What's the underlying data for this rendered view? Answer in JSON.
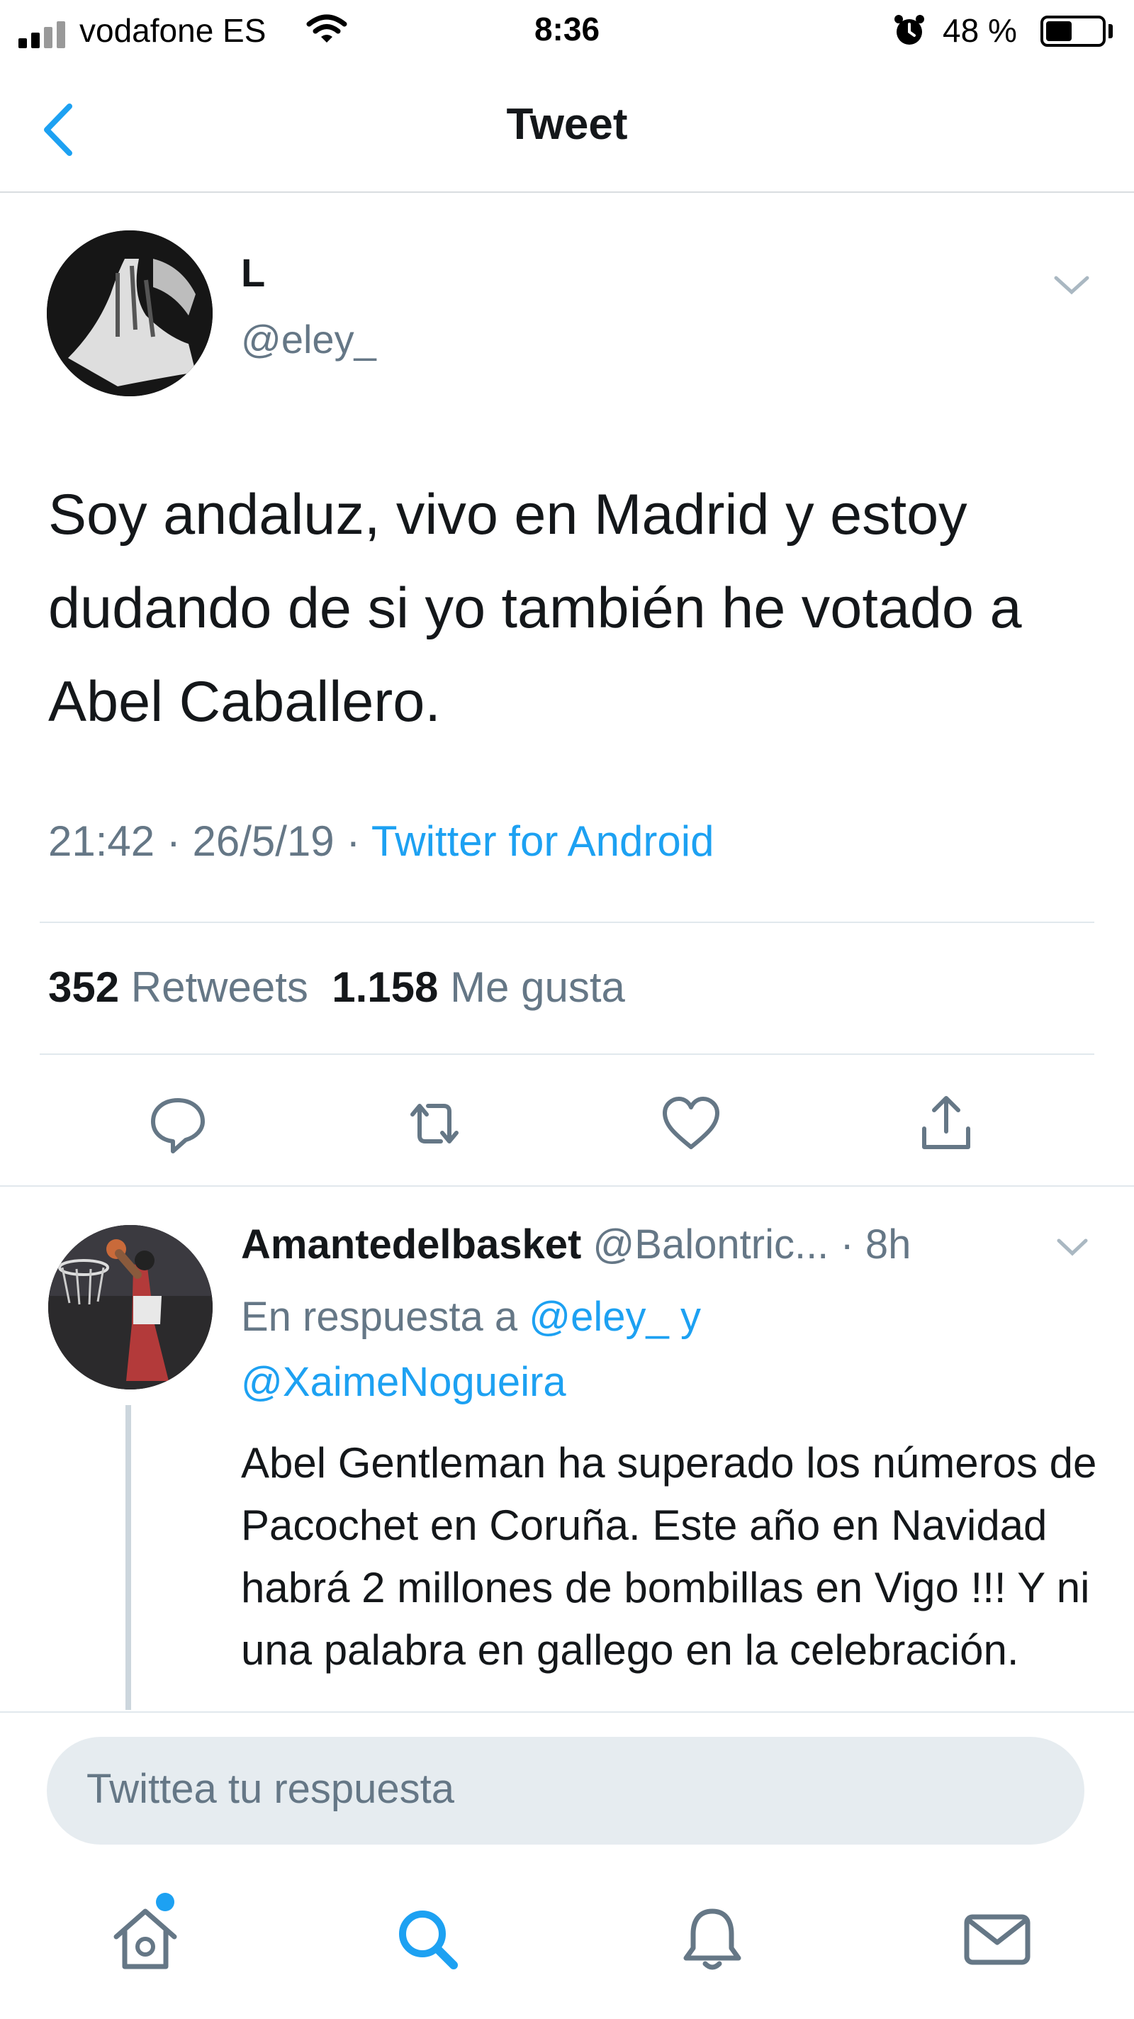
{
  "status_bar": {
    "carrier": "vodafone ES",
    "time": "8:36",
    "battery_percent": "48 %",
    "battery_level": 0.48
  },
  "nav": {
    "title": "Tweet"
  },
  "tweet": {
    "display_name": "L",
    "handle": "@eley_",
    "text": "Soy andaluz, vivo en Madrid y estoy dudando de si yo también he votado a Abel Caballero.",
    "time": "21:42",
    "date": "26/5/19",
    "separator": "·",
    "source": "Twitter for Android",
    "retweets_count": "352",
    "retweets_label": "Retweets",
    "likes_count": "1.158",
    "likes_label": "Me gusta"
  },
  "reply": {
    "display_name": "Amantedelbasket",
    "handle": "@Balontric...",
    "age": "· 8h",
    "in_reply_prefix": "En respuesta a",
    "mention1": "@eley_",
    "conj": "y",
    "mention2": "@XaimeNogueira",
    "text": "Abel Gentleman ha superado los números de Pacochet en Coruña. Este año en Navidad habrá 2 millones de bombillas en Vigo !!! Y ni una palabra en gallego en la celebración."
  },
  "compose": {
    "placeholder": "Twittea tu respuesta"
  },
  "colors": {
    "accent": "#1da1f2",
    "secondary_text": "#657786",
    "primary_text": "#14171a"
  },
  "icons": [
    "signal-icon",
    "wifi-icon",
    "alarm-icon",
    "battery-icon",
    "back-chevron-icon",
    "caret-down-icon",
    "reply-icon",
    "retweet-icon",
    "like-icon",
    "share-icon",
    "home-icon",
    "search-icon",
    "notifications-icon",
    "messages-icon"
  ]
}
